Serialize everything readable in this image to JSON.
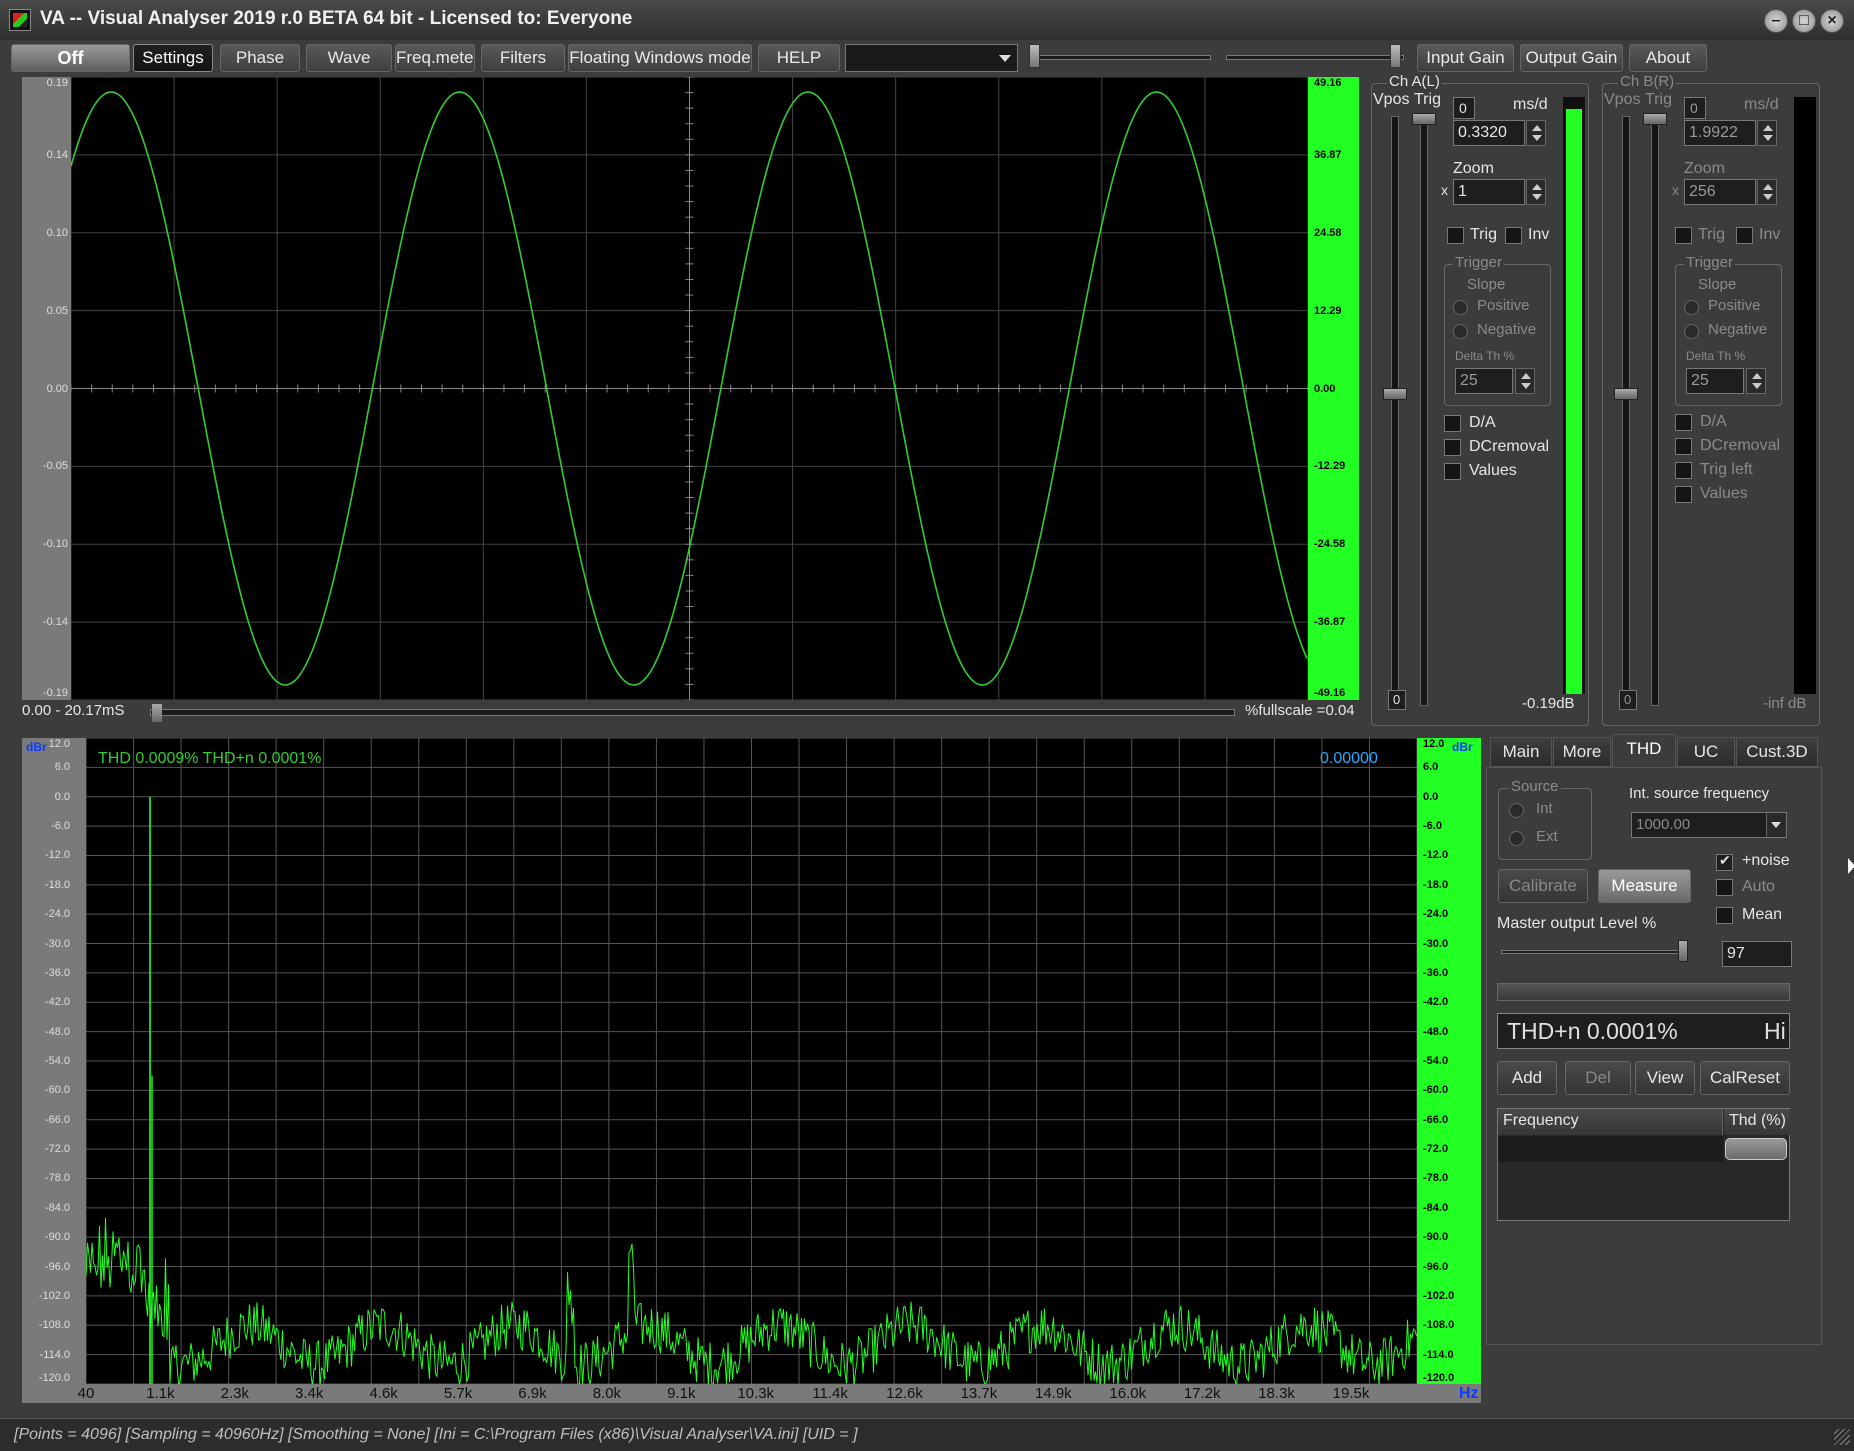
{
  "window": {
    "title": "VA -- Visual Analyser 2019 r.0 BETA 64 bit - Licensed to: Everyone"
  },
  "toolbar": {
    "off": "Off",
    "settings": "Settings",
    "phase": "Phase",
    "wave": "Wave",
    "freqmeter": "Freq.meter",
    "filters": "Filters",
    "floating": "Floating Windows mode",
    "help": "HELP",
    "input_gain": "Input Gain",
    "output_gain": "Output Gain",
    "about": "About"
  },
  "scope": {
    "y_left": [
      "0.19",
      "0.14",
      "0.10",
      "0.05",
      "0.00",
      "-0.05",
      "-0.10",
      "-0.14",
      "-0.19"
    ],
    "y_right": [
      "49.16",
      "36.87",
      "24.58",
      "12.29",
      "0.00",
      "-12.29",
      "-24.58",
      "-36.87",
      "-49.16"
    ],
    "time_range": "0.00 - 20.17mS",
    "fullscale": "%fullscale =0.04",
    "trace_color": "#33cc33",
    "right_bar_color": "#22ff22"
  },
  "chA": {
    "title": "Ch A(L)",
    "vpos": "Vpos",
    "trig": "Trig",
    "zero_top": "0",
    "ms_d": "ms/d",
    "ms_value": "0.3320",
    "zoom": "Zoom",
    "x": "x",
    "zoom_value": "1",
    "chk_trig": "Trig",
    "chk_inv": "Inv",
    "trigger": "Trigger",
    "slope": "Slope",
    "positive": "Positive",
    "negative": "Negative",
    "delta": "Delta Th %",
    "delta_value": "25",
    "da": "D/A",
    "dcremoval": "DCremoval",
    "values": "Values",
    "zero_bottom": "0",
    "level": "-0.19dB",
    "meter_level": 0.98
  },
  "chB": {
    "title": "Ch B(R)",
    "vpos": "Vpos",
    "trig": "Trig",
    "zero_top": "0",
    "ms_d": "ms/d",
    "ms_value": "1.9922",
    "zoom": "Zoom",
    "x": "x",
    "zoom_value": "256",
    "chk_trig": "Trig",
    "chk_inv": "Inv",
    "trigger": "Trigger",
    "slope": "Slope",
    "positive": "Positive",
    "negative": "Negative",
    "delta": "Delta Th %",
    "delta_value": "25",
    "da": "D/A",
    "dcremoval": "DCremoval",
    "trigleft": "Trig left",
    "values": "Values",
    "zero_bottom": "0",
    "level": "-inf dB"
  },
  "spectrum": {
    "unit": "dBr",
    "unit_right": "dBr",
    "y_labels": [
      "12.0",
      "6.0",
      "0.0",
      "-6.0",
      "-12.0",
      "-18.0",
      "-24.0",
      "-30.0",
      "-36.0",
      "-42.0",
      "-48.0",
      "-54.0",
      "-60.0",
      "-66.0",
      "-72.0",
      "-78.0",
      "-84.0",
      "-90.0",
      "-96.0",
      "-102.0",
      "-108.0",
      "-114.0",
      "-120.0"
    ],
    "x_labels": [
      "40",
      "1.1k",
      "2.3k",
      "3.4k",
      "4.6k",
      "5.7k",
      "6.9k",
      "8.0k",
      "9.1k",
      "10.3k",
      "11.4k",
      "12.6k",
      "13.7k",
      "14.9k",
      "16.0k",
      "17.2k",
      "18.3k",
      "19.5k"
    ],
    "x_unit": "Hz",
    "thd_readout": "THD 0.0009% THD+n 0.0001%",
    "value_readout": "0.00000"
  },
  "tabs": [
    "Main",
    "More",
    "THD",
    "UC",
    "Cust.3D"
  ],
  "thd": {
    "source": "Source",
    "int": "Int",
    "ext": "Ext",
    "int_freq_label": "Int. source frequency",
    "int_freq_value": "1000.00",
    "noise": "+noise",
    "auto": "Auto",
    "mean": "Mean",
    "calibrate": "Calibrate",
    "measure": "Measure",
    "master_level": "Master output Level %",
    "master_value": "97",
    "readout": "THD+n 0.0001%",
    "readout_hi": "Hi",
    "add": "Add",
    "del": "Del",
    "view": "View",
    "calreset": "CalReset",
    "col_freq": "Frequency",
    "col_thd": "Thd (%)"
  },
  "status": "[Points = 4096]  [Sampling = 40960Hz]  [Smoothing = None]  [Ini = C:\\Program Files (x86)\\Visual Analyser\\VA.ini]  [UID = ]"
}
